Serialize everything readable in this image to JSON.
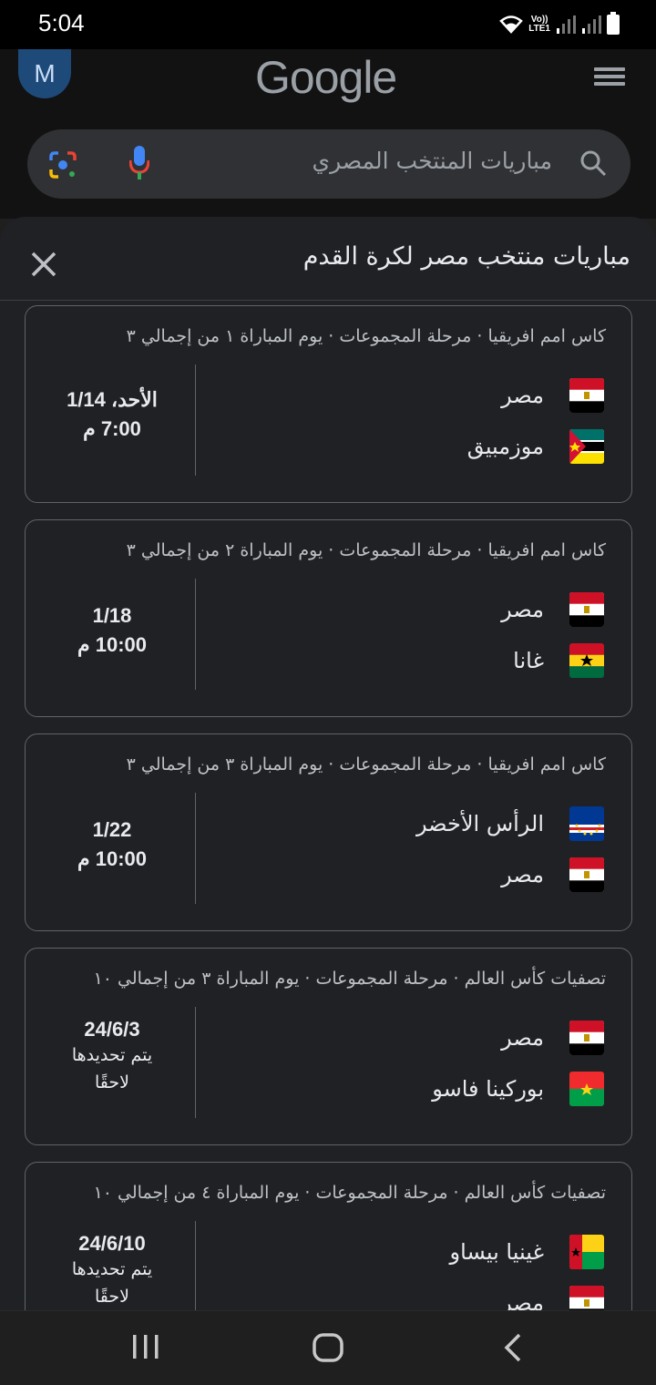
{
  "status": {
    "time": "5:04",
    "net_top": "Vo))",
    "net_bottom": "LTE1"
  },
  "header": {
    "avatar_letter": "M",
    "logo": "Google"
  },
  "search": {
    "query": "مباريات المنتخب المصري"
  },
  "sheet": {
    "title": "مباريات منتخب مصر لكرة القدم"
  },
  "matches": [
    {
      "meta": "كاس امم افريقيا · مرحلة المجموعات · يوم المباراة ١ من إجمالي ٣",
      "team1": "مصر",
      "flag1": "egypt-flag-icon",
      "team2": "موزمبيق",
      "flag2": "mozambique-flag-icon",
      "date": "الأحد، 1/14",
      "time": "7:00 م"
    },
    {
      "meta": "كاس امم افريقيا · مرحلة المجموعات · يوم المباراة ٢ من إجمالي ٣",
      "team1": "مصر",
      "flag1": "egypt-flag-icon",
      "team2": "غانا",
      "flag2": "ghana-flag-icon",
      "date": "1/18",
      "time": "10:00 م"
    },
    {
      "meta": "كاس امم افريقيا · مرحلة المجموعات · يوم المباراة ٣ من إجمالي ٣",
      "team1": "الرأس الأخضر",
      "flag1": "cape-verde-flag-icon",
      "team2": "مصر",
      "flag2": "egypt-flag-icon",
      "date": "1/22",
      "time": "10:00 م"
    },
    {
      "meta": "تصفيات كأس العالم · مرحلة المجموعات · يوم المباراة ٣ من إجمالي ١٠",
      "team1": "مصر",
      "flag1": "egypt-flag-icon",
      "team2": "بوركينا فاسو",
      "flag2": "burkina-faso-flag-icon",
      "date": "24/6/3",
      "tbd1": "يتم تحديدها",
      "tbd2": "لاحقًا"
    },
    {
      "meta": "تصفيات كأس العالم · مرحلة المجموعات · يوم المباراة ٤ من إجمالي ١٠",
      "team1": "غينيا بيساو",
      "flag1": "guinea-bissau-flag-icon",
      "team2": "مصر",
      "flag2": "egypt-flag-icon",
      "date": "24/6/10",
      "tbd1": "يتم تحديدها",
      "tbd2": "لاحقًا"
    }
  ],
  "colors": {
    "background": "#202124",
    "card_border": "#5f6368",
    "text": "#e8eaed",
    "meta_text": "#bdc1c6"
  }
}
